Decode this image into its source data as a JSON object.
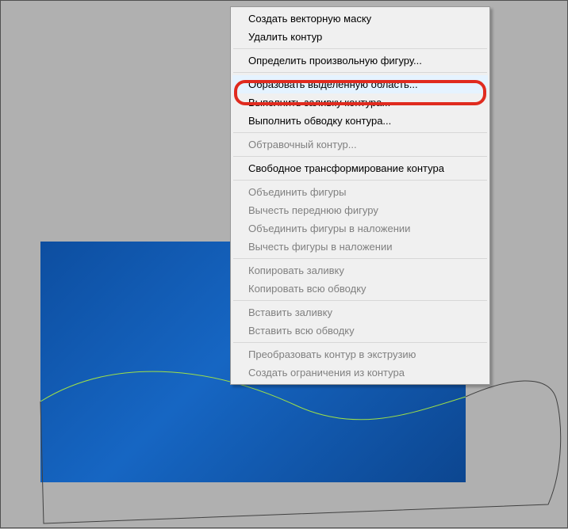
{
  "menu": {
    "groups": [
      [
        {
          "label": "Создать векторную маску",
          "disabled": false
        },
        {
          "label": "Удалить контур",
          "disabled": false
        }
      ],
      [
        {
          "label": "Определить произвольную фигуру...",
          "disabled": false
        }
      ],
      [
        {
          "label": "Образовать выделенную область...",
          "disabled": false,
          "hover": true
        },
        {
          "label": "Выполнить заливку контура...",
          "disabled": false
        },
        {
          "label": "Выполнить обводку контура...",
          "disabled": false
        }
      ],
      [
        {
          "label": "Обтравочный контур...",
          "disabled": true
        }
      ],
      [
        {
          "label": "Свободное трансформирование контура",
          "disabled": false
        }
      ],
      [
        {
          "label": "Объединить фигуры",
          "disabled": true
        },
        {
          "label": "Вычесть переднюю фигуру",
          "disabled": true
        },
        {
          "label": "Объединить фигуры в наложении",
          "disabled": true
        },
        {
          "label": "Вычесть фигуры в наложении",
          "disabled": true
        }
      ],
      [
        {
          "label": "Копировать заливку",
          "disabled": true
        },
        {
          "label": "Копировать всю обводку",
          "disabled": true
        }
      ],
      [
        {
          "label": "Вставить заливку",
          "disabled": true
        },
        {
          "label": "Вставить всю обводку",
          "disabled": true
        }
      ],
      [
        {
          "label": "Преобразовать контур в экструзию",
          "disabled": true
        },
        {
          "label": "Создать ограничения из контура",
          "disabled": true
        }
      ]
    ]
  }
}
